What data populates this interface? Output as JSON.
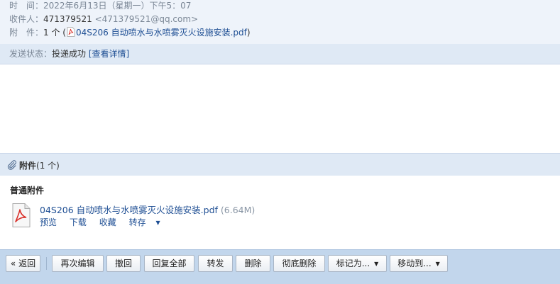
{
  "header": {
    "time_label": "时　间：",
    "time_value": "2022年6月13日（星期一）下午5：07",
    "to_label": "收件人：",
    "to_name": "471379521",
    "to_email": "<471379521@qq.com>",
    "attach_label": "附　件：",
    "attach_count": "1 个 (",
    "attach_file": "04S206 自动喷水与水喷雾灭火设施安装.pdf",
    "attach_close": ")"
  },
  "status": {
    "label": "发送状态：",
    "value": "投递成功",
    "details_link": "[查看详情]"
  },
  "attachments": {
    "title": "附件",
    "count": "(1 个)",
    "section_label": "普通附件",
    "file": {
      "name": "04S206 自动喷水与水喷雾灭火设施安装.pdf",
      "size": "(6.64M)",
      "icon": "pdf-file-icon"
    },
    "actions": {
      "preview": "预览",
      "download": "下载",
      "favorite": "收藏",
      "save_to": "转存",
      "save_to_arrow": "▼"
    }
  },
  "toolbar": {
    "back": "« 返回",
    "edit_again": "再次编辑",
    "recall": "撤回",
    "reply_all": "回复全部",
    "forward": "转发",
    "delete": "删除",
    "delete_permanent": "彻底删除",
    "mark_as": "标记为...",
    "move_to": "移动到...",
    "dropdown_arrow": "▼"
  },
  "colors": {
    "header_bg": "#eef3fa",
    "status_bg": "#dfe9f5",
    "toolbar_bg": "#c2d6ec",
    "link": "#1f4f94"
  }
}
